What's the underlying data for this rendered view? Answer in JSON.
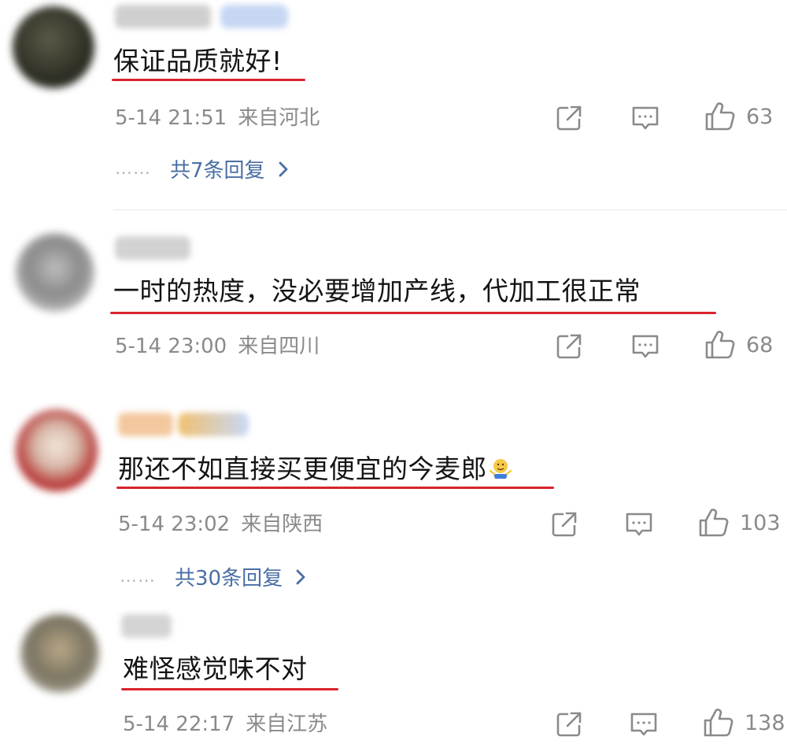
{
  "comments": [
    {
      "text": "保证品质就好!",
      "time": "5-14 21:51",
      "location": "来自河北",
      "likes": "63",
      "replies_label": "共7条回复",
      "replies_dots": "……",
      "avatar_color": "#3a3a2e"
    },
    {
      "text": "一时的热度，没必要增加产线，代加工很正常",
      "time": "5-14 23:00",
      "location": "来自四川",
      "likes": "68",
      "avatar_color": "#6c6c6c"
    },
    {
      "text": "那还不如直接买更便宜的今麦郎",
      "emoji": "shrug-emoji",
      "time": "5-14 23:02",
      "location": "来自陕西",
      "likes": "103",
      "replies_label": "共30条回复",
      "replies_dots": "……",
      "avatar_color": "#b32a2a"
    },
    {
      "text": "难怪感觉味不对",
      "time": "5-14 22:17",
      "location": "来自江苏",
      "likes": "138",
      "avatar_color": "#7a7462"
    }
  ],
  "colors": {
    "underline": "#d9232d",
    "reply_link": "#4a6fa5",
    "meta": "#8a8a8a"
  },
  "icons": {
    "share": "share-icon",
    "comment": "comment-icon",
    "like": "thumbs-up-icon",
    "chevron": "chevron-right-icon"
  }
}
